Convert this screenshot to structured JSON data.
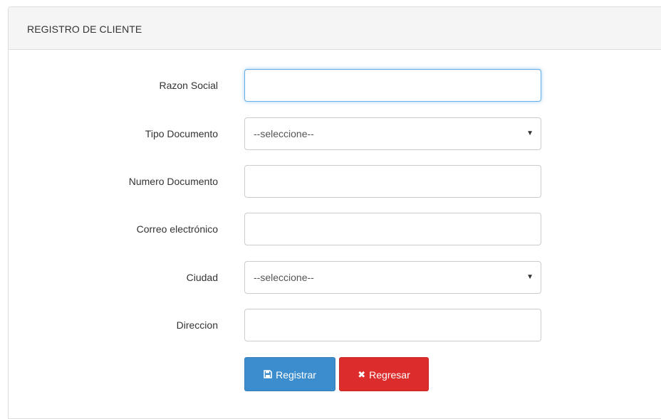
{
  "panel": {
    "title": "REGISTRO DE CLIENTE"
  },
  "form": {
    "razon_social": {
      "label": "Razon Social",
      "value": "",
      "placeholder": ""
    },
    "tipo_documento": {
      "label": "Tipo Documento",
      "selected": "--seleccione--"
    },
    "numero_documento": {
      "label": "Numero Documento",
      "value": "",
      "placeholder": ""
    },
    "correo": {
      "label": "Correo electrónico",
      "value": "",
      "placeholder": ""
    },
    "ciudad": {
      "label": "Ciudad",
      "selected": "--seleccione--"
    },
    "direccion": {
      "label": "Direccion",
      "value": "",
      "placeholder": ""
    }
  },
  "buttons": {
    "registrar": {
      "label": "Registrar",
      "icon": "save-icon",
      "color": "#3c8dcd"
    },
    "regresar": {
      "label": "Regresar",
      "icon": "close-icon",
      "color": "#dd2c2c"
    }
  }
}
